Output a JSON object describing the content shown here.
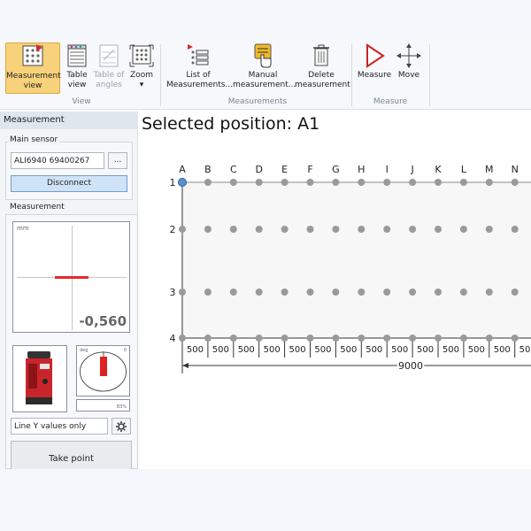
{
  "ribbon": {
    "buttons": {
      "measurement_view": "Measurement view",
      "table_view": "Table view",
      "table_of_angles": "Table of angles",
      "zoom": "Zoom",
      "zoom_arrow": "▾",
      "list_of_measurements": "List of Measurements...",
      "manual_measurement": "Manual measurement...",
      "delete_measurement": "Delete measurement",
      "measure": "Measure",
      "move": "Move"
    },
    "groups": {
      "view": "View",
      "measurements": "Measurements",
      "measure": "Measure"
    }
  },
  "panel": {
    "title": "Measurement",
    "main_sensor": {
      "legend": "Main sensor",
      "sensor_value": "ALI6940 69400267",
      "browse_label": "...",
      "disconnect_label": "Disconnect"
    },
    "measurement": {
      "legend": "Measurement",
      "unit": "mm",
      "reading": "-0,560",
      "gauge_unit": "deg",
      "gauge_zero": "0",
      "percent": "83%",
      "mode_value": "Line Y values only",
      "take_point_label": "Take point"
    }
  },
  "main": {
    "title": "Selected position: A1",
    "grid": {
      "columns": [
        "A",
        "B",
        "C",
        "D",
        "E",
        "F",
        "G",
        "H",
        "I",
        "J",
        "K",
        "L",
        "M",
        "N"
      ],
      "rows": [
        "1",
        "2",
        "3",
        "4"
      ],
      "selected": "A1",
      "spacing_labels": [
        "500",
        "500",
        "500",
        "500",
        "500",
        "500",
        "500",
        "500",
        "500",
        "500",
        "500",
        "500",
        "500",
        "500"
      ],
      "total_length": "9000"
    }
  },
  "colors": {
    "active_button": "#f8d27a",
    "selected_point": "#5b8fd1",
    "point": "#9a9a9a",
    "reading_bar": "#e52a2a"
  }
}
